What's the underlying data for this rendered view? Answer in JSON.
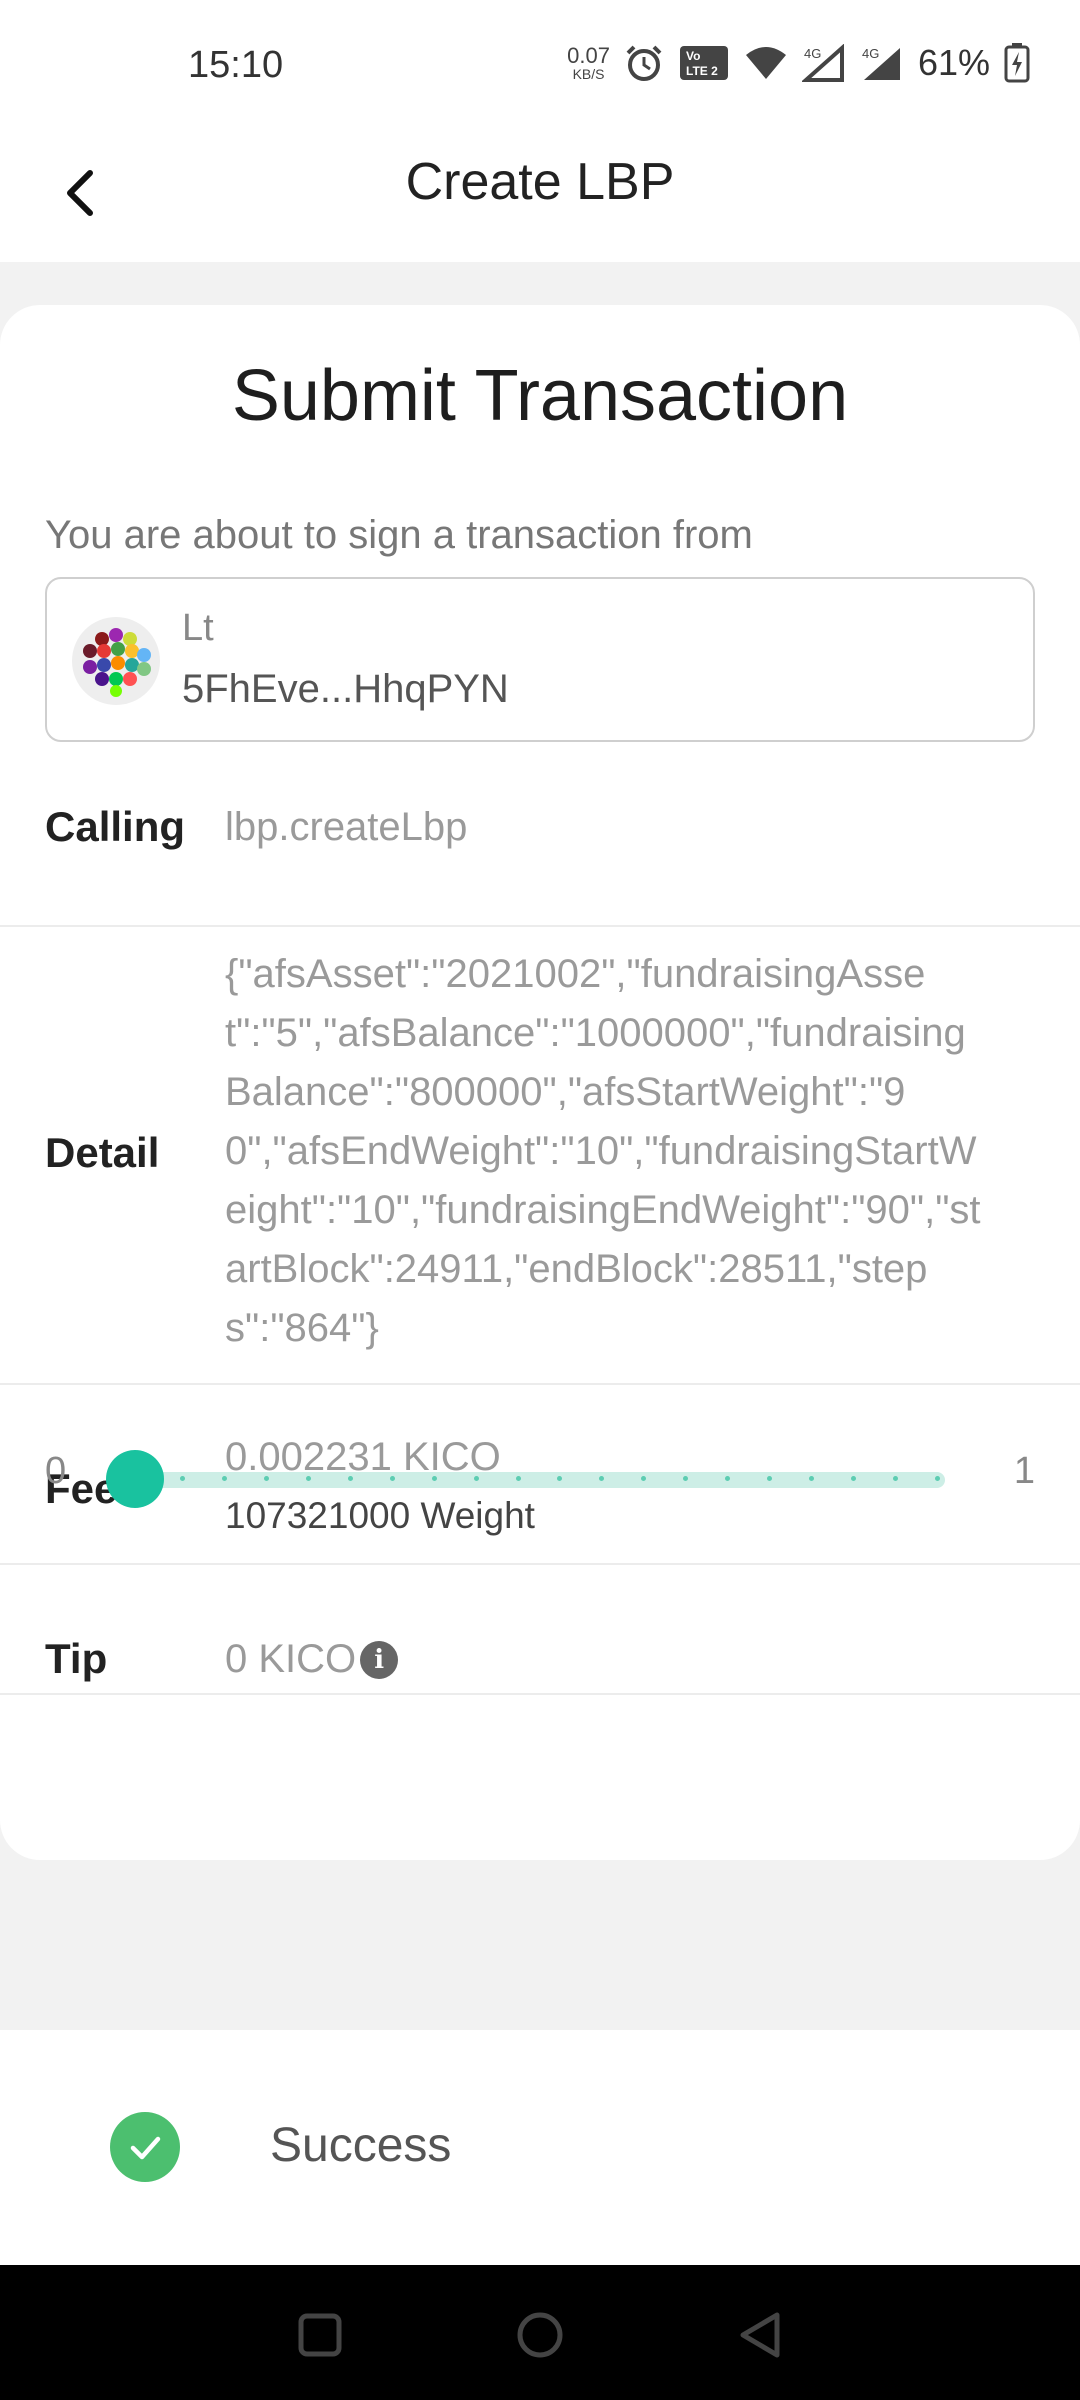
{
  "status_bar": {
    "time": "15:10",
    "net_speed_value": "0.07",
    "net_speed_unit": "KB/S",
    "battery_percent": "61%",
    "icons": [
      "alarm-icon",
      "volte-icon",
      "wifi-icon",
      "signal-4g-icon",
      "signal-4g-icon",
      "battery-charging-icon"
    ]
  },
  "header": {
    "title": "Create LBP",
    "back_icon": "chevron-left-icon"
  },
  "card": {
    "title": "Submit Transaction",
    "sign_note": "You are about to sign a transaction from",
    "account": {
      "name": "Lt",
      "address": "5FhEve...HhqPYN"
    },
    "calling": {
      "label": "Calling",
      "value": "lbp.createLbp"
    },
    "detail": {
      "label": "Detail",
      "value": "{\"afsAsset\":\"2021002\",\"fundraisingAsset\":\"5\",\"afsBalance\":\"1000000\",\"fundraisingBalance\":\"800000\",\"afsStartWeight\":\"90\",\"afsEndWeight\":\"10\",\"fundraisingStartWeight\":\"10\",\"fundraisingEndWeight\":\"90\",\"startBlock\":24911,\"endBlock\":28511,\"steps\":\"864\"}"
    },
    "fees": {
      "label": "Fees",
      "value": "0.002231 KICO",
      "weight": "107321000 Weight"
    },
    "tip": {
      "label": "Tip",
      "value": "0 KICO"
    },
    "tip_slider": {
      "min_label": "0",
      "max_label": "1",
      "value": 0,
      "accent_color": "#19c29f"
    }
  },
  "toast": {
    "text": "Success",
    "icon": "check-circle-icon",
    "color": "#4cbf6f"
  },
  "nav_bar": {
    "buttons": [
      "recents-square-icon",
      "home-circle-icon",
      "back-triangle-icon"
    ]
  }
}
